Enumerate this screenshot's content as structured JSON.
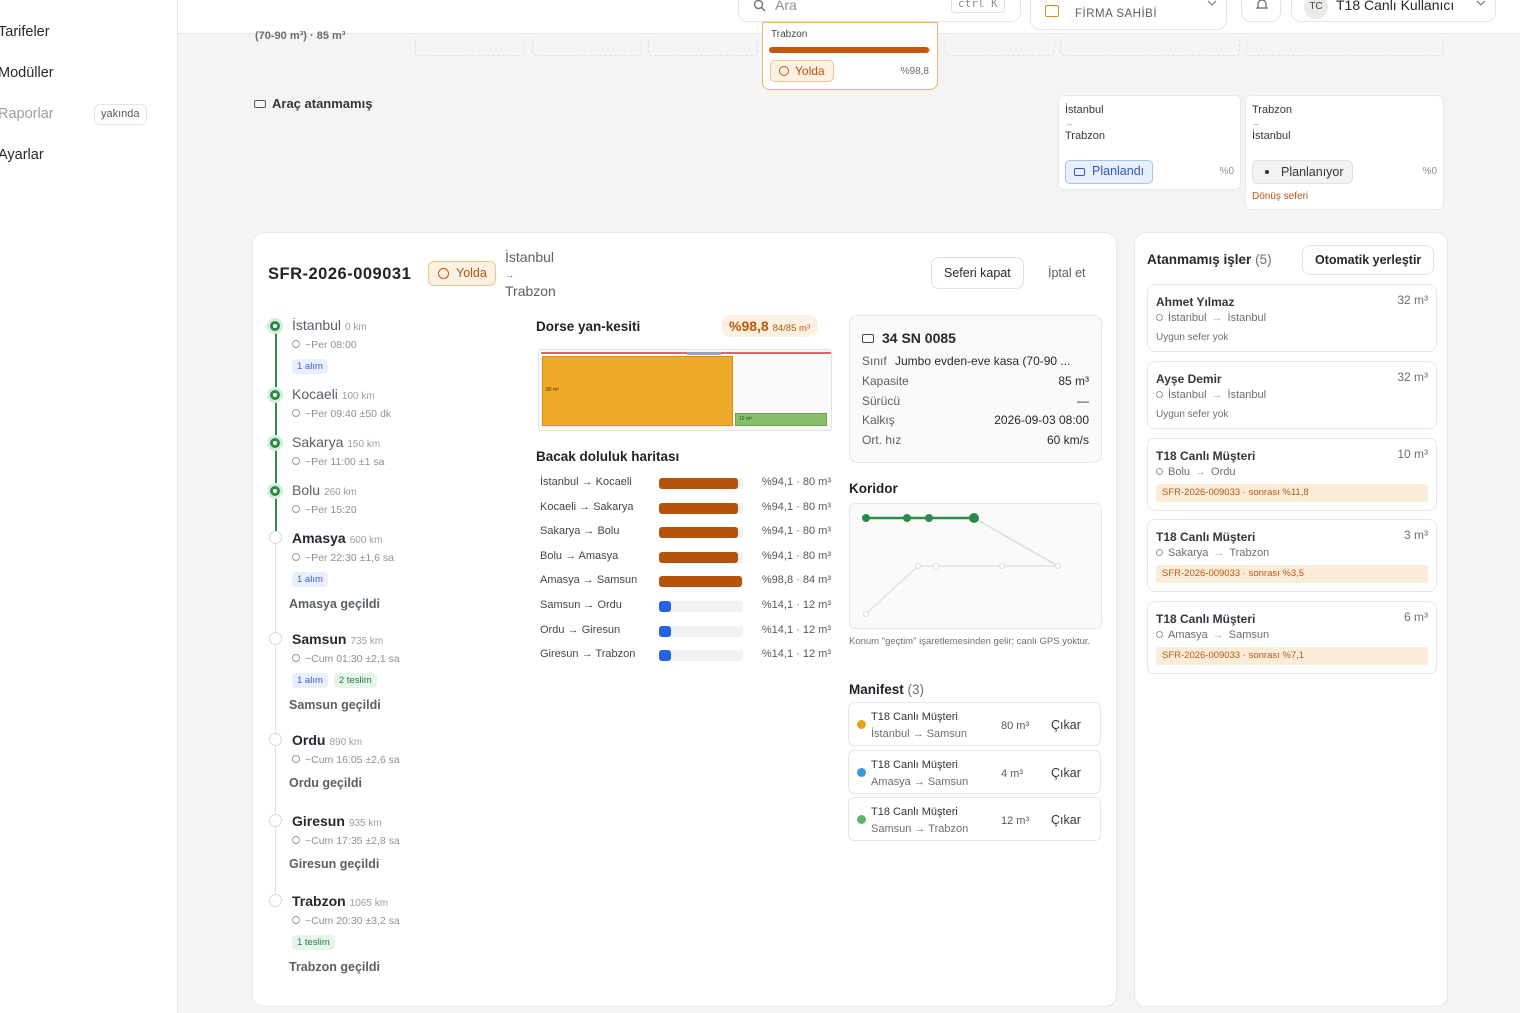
{
  "sidebar": {
    "items": [
      {
        "label": "Tarifeler"
      },
      {
        "label": "Modüller"
      },
      {
        "label": "Raporlar",
        "badge": "yakında"
      },
      {
        "label": "Ayarlar"
      }
    ]
  },
  "topbar": {
    "search_placeholder": "Ara",
    "search_shortcut": "ctrl K",
    "role": "FİRMA SAHİBİ",
    "user_initials": "TC",
    "user_name": "T18 Canlı Kullanıcı"
  },
  "board": {
    "top_fragment": "(70-90 m³) · 85 m³",
    "highlight_card": {
      "route_tail": "Trabzon",
      "status": "Yolda",
      "pct": "%98,8",
      "fill_ratio": 0.988
    },
    "unassigned_label": "Araç atanmamış",
    "cards": [
      {
        "from": "İstanbul",
        "arrow": "→",
        "to": "Trabzon",
        "status": "Planlandı",
        "pct": "%0"
      },
      {
        "from": "Trabzon",
        "arrow": "→",
        "to": "İstanbul",
        "status": "Planlanıyor",
        "pct": "%0",
        "note": "Dönüş seferi"
      }
    ]
  },
  "trip": {
    "id": "SFR-2026-009031",
    "status": "Yolda",
    "from": "İstanbul",
    "arrow": "→",
    "to": "Trabzon",
    "close_button": "Seferi kapat",
    "cancel_button": "İptal et",
    "stops": [
      {
        "name": "İstanbul",
        "km": "0 km",
        "eta": "~Per 08:00",
        "badges": [
          "1 alım"
        ],
        "done": true
      },
      {
        "name": "Kocaeli",
        "km": "100 km",
        "eta": "~Per 09:40 ±50 dk",
        "badges": [],
        "done": true
      },
      {
        "name": "Sakarya",
        "km": "150 km",
        "eta": "~Per 11:00 ±1 sa",
        "badges": [],
        "done": true
      },
      {
        "name": "Bolu",
        "km": "260 km",
        "eta": "~Per 15:20",
        "badges": [],
        "done": true
      },
      {
        "name": "Amasya",
        "km": "600 km",
        "eta": "~Per 22:30 ±1,6 sa",
        "badges": [
          "1 alım"
        ],
        "done": false,
        "passed": "Amasya geçildi"
      },
      {
        "name": "Samsun",
        "km": "735 km",
        "eta": "~Cum 01:30 ±2,1 sa",
        "badges": [
          "1 alım",
          "2 teslim"
        ],
        "done": false,
        "passed": "Samsun geçildi"
      },
      {
        "name": "Ordu",
        "km": "890 km",
        "eta": "~Cum 16:05 ±2,6 sa",
        "badges": [],
        "done": false,
        "passed": "Ordu geçildi"
      },
      {
        "name": "Giresun",
        "km": "935 km",
        "eta": "~Cum 17:35 ±2,8 sa",
        "badges": [],
        "done": false,
        "passed": "Giresun geçildi"
      },
      {
        "name": "Trabzon",
        "km": "1065 km",
        "eta": "~Cum 20:30 ±3,2 sa",
        "badges": [
          "1 teslim"
        ],
        "done": false,
        "passed": "Trabzon geçildi"
      }
    ],
    "cross_section": {
      "title": "Dorse yan-kesiti",
      "pct": "%98,8",
      "volume": "84/85 m³",
      "main_block": "80 m³",
      "small_block": "12 m³",
      "main_ratio": 0.66,
      "small_ratio": 0.33
    },
    "leg_map": {
      "title": "Bacak doluluk haritası",
      "rows": [
        {
          "leg": "İstanbul → Kocaeli",
          "value": "%94,1 · 80 m³",
          "ratio": 0.941,
          "color": "#b45309"
        },
        {
          "leg": "Kocaeli → Sakarya",
          "value": "%94,1 · 80 m³",
          "ratio": 0.941,
          "color": "#b45309"
        },
        {
          "leg": "Sakarya → Bolu",
          "value": "%94,1 · 80 m³",
          "ratio": 0.941,
          "color": "#b45309"
        },
        {
          "leg": "Bolu → Amasya",
          "value": "%94,1 · 80 m³",
          "ratio": 0.941,
          "color": "#b45309"
        },
        {
          "leg": "Amasya → Samsun",
          "value": "%98,8 · 84 m³",
          "ratio": 0.988,
          "color": "#b45309"
        },
        {
          "leg": "Samsun → Ordu",
          "value": "%14,1 · 12 m³",
          "ratio": 0.141,
          "color": "#2563eb"
        },
        {
          "leg": "Ordu → Giresun",
          "value": "%14,1 · 12 m³",
          "ratio": 0.141,
          "color": "#2563eb"
        },
        {
          "leg": "Giresun → Trabzon",
          "value": "%14,1 · 12 m³",
          "ratio": 0.141,
          "color": "#2563eb"
        }
      ]
    },
    "vehicle": {
      "plate": "34 SN 0085",
      "rows": [
        {
          "k": "Sınıf",
          "v": "Jumbo evden-eve kasa (70-90 ..."
        },
        {
          "k": "Kapasite",
          "v": "85 m³"
        },
        {
          "k": "Sürücü",
          "v": "—"
        },
        {
          "k": "Kalkış",
          "v": "2026-09-03 08:00"
        },
        {
          "k": "Ort. hız",
          "v": "60 km/s"
        }
      ]
    },
    "corridor": {
      "title": "Koridor",
      "note": "Konum \"geçtim\" işaretlemesinden gelir; canlı GPS yoktur."
    },
    "manifest": {
      "title": "Manifest",
      "count": "(3)",
      "rows": [
        {
          "name": "T18 Canlı Müşteri",
          "route": "İstanbul → Samsun",
          "vol": "80 m³",
          "action": "Çıkar",
          "color": "#e8a317"
        },
        {
          "name": "T18 Canlı Müşteri",
          "route": "Amasya → Samsun",
          "vol": "4 m³",
          "action": "Çıkar",
          "color": "#3b9bd9"
        },
        {
          "name": "T18 Canlı Müşteri",
          "route": "Samsun → Trabzon",
          "vol": "12 m³",
          "action": "Çıkar",
          "color": "#5fb36a"
        }
      ]
    }
  },
  "jobs": {
    "title": "Atanmamış işler",
    "count": "(5)",
    "auto_button": "Otomatik yerleştir",
    "items": [
      {
        "name": "Ahmet Yılmaz",
        "vol": "32 m³",
        "from": "İstanbul",
        "arrow": "→",
        "to": "İstanbul",
        "note": "Uygun sefer yok"
      },
      {
        "name": "Ayşe Demir",
        "vol": "32 m³",
        "from": "İstanbul",
        "arrow": "→",
        "to": "İstanbul",
        "note": "Uygun sefer yok"
      },
      {
        "name": "T18 Canlı Müşteri",
        "vol": "10 m³",
        "from": "Bolu",
        "arrow": "→",
        "to": "Ordu",
        "hint": "SFR-2026-009033 · sonrası %11,8"
      },
      {
        "name": "T18 Canlı Müşteri",
        "vol": "3 m³",
        "from": "Sakarya",
        "arrow": "→",
        "to": "Trabzon",
        "hint": "SFR-2026-009033 · sonrası %3,5"
      },
      {
        "name": "T18 Canlı Müşteri",
        "vol": "6 m³",
        "from": "Amasya",
        "arrow": "→",
        "to": "Samsun",
        "hint": "SFR-2026-009033 · sonrası %7,1"
      }
    ]
  }
}
